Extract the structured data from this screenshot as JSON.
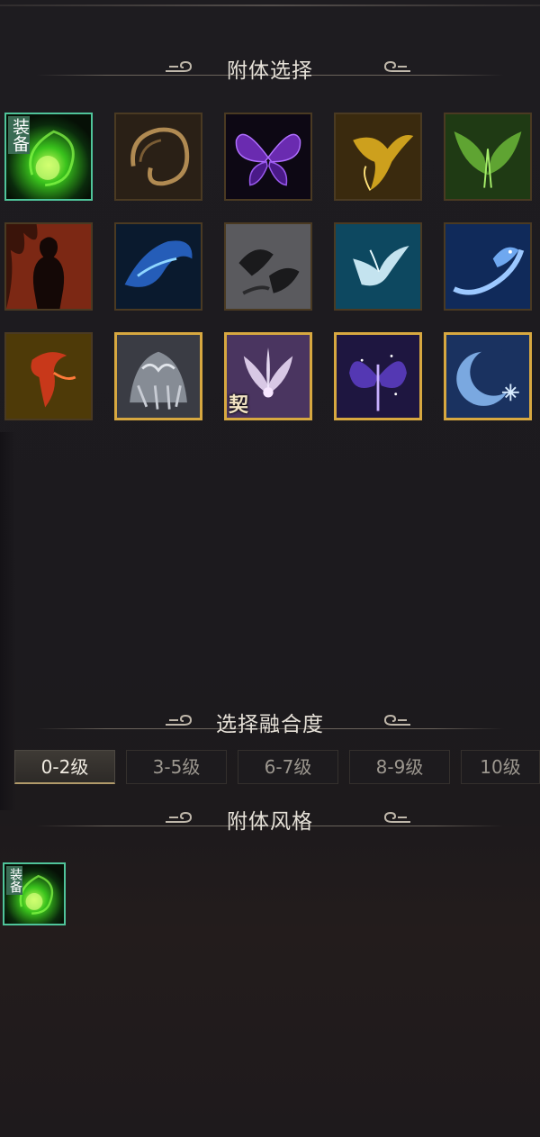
{
  "sections": {
    "attach_select": "附体选择",
    "fusion_select": "选择融合度",
    "attach_style": "附体风格"
  },
  "tags": {
    "equipped": "装备",
    "contract": "契"
  },
  "icons": [
    {
      "name": "green-flame-spirit",
      "state": "equipped"
    },
    {
      "name": "golden-dragon-swirl",
      "state": "normal"
    },
    {
      "name": "purple-butterfly",
      "state": "normal"
    },
    {
      "name": "golden-phoenix",
      "state": "normal"
    },
    {
      "name": "green-phoenix-wings",
      "state": "normal"
    },
    {
      "name": "fire-silhouette",
      "state": "normal"
    },
    {
      "name": "blue-flame-fish",
      "state": "normal"
    },
    {
      "name": "dark-raven",
      "state": "normal"
    },
    {
      "name": "ice-crane",
      "state": "normal"
    },
    {
      "name": "blue-dragon",
      "state": "normal"
    },
    {
      "name": "red-phoenix",
      "state": "normal"
    },
    {
      "name": "white-tiger-beast",
      "state": "gold"
    },
    {
      "name": "nine-tail-fox",
      "state": "gold-contract"
    },
    {
      "name": "violet-butterfly-fairy",
      "state": "gold"
    },
    {
      "name": "moon-snowflake",
      "state": "gold"
    }
  ],
  "levels": [
    "0-2级",
    "3-5级",
    "6-7级",
    "8-9级",
    "10级"
  ],
  "active_level": "0-2级",
  "style_icon": {
    "name": "green-flame-spirit",
    "state": "equipped"
  },
  "colors": {
    "selected_border": "#4fc49a",
    "gold_border": "#d7a840",
    "equipped_tag": "#3a6b54"
  }
}
